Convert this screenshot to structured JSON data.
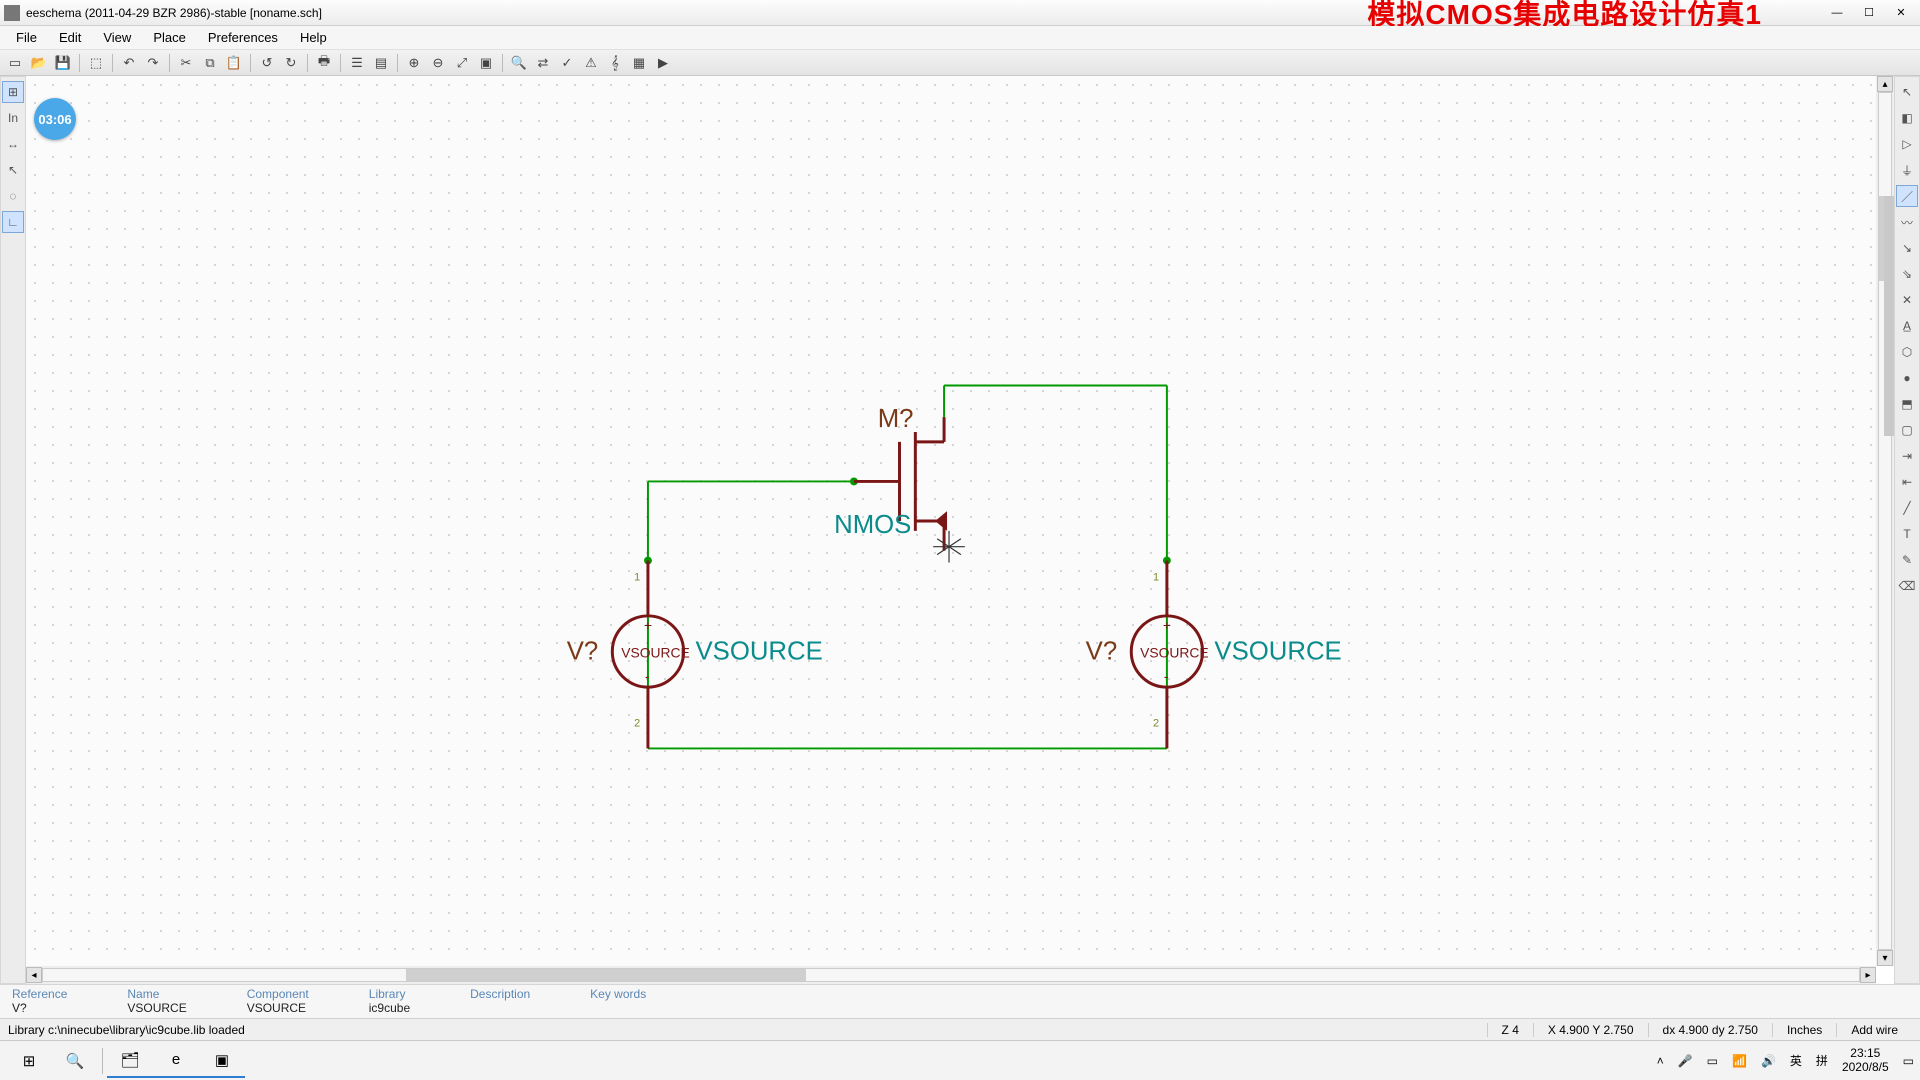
{
  "window": {
    "title": "eeschema (2011-04-29 BZR 2986)-stable [noname.sch]",
    "overlay_text": "模拟CMOS集成电路设计仿真1"
  },
  "menubar": [
    "File",
    "Edit",
    "View",
    "Place",
    "Preferences",
    "Help"
  ],
  "timer": "03:06",
  "schematic": {
    "nmos_ref": "M?",
    "nmos_name": "NMOS",
    "vsource_left_ref": "V?",
    "vsource_left_name": "VSOURCE",
    "vsource_left_inner": "VSOURCE",
    "vsource_right_ref": "V?",
    "vsource_right_name": "VSOURCE",
    "vsource_right_inner": "VSOURCE",
    "pin1": "1",
    "pin2": "2"
  },
  "info": {
    "headers": [
      "Reference",
      "Name",
      "Component",
      "Library",
      "Description",
      "Key words"
    ],
    "values": [
      "V?",
      "VSOURCE",
      "VSOURCE",
      "ic9cube",
      "",
      ""
    ]
  },
  "status": {
    "message": "Library c:\\ninecube\\library\\ic9cube.lib loaded",
    "zoom": "Z 4",
    "xy": "X 4.900  Y 2.750",
    "dxy": "dx 4.900  dy 2.750",
    "units": "Inches",
    "mode": "Add wire"
  },
  "taskbar": {
    "ime1": "英",
    "ime2": "拼",
    "time": "23:15",
    "date": "2020/8/5"
  }
}
